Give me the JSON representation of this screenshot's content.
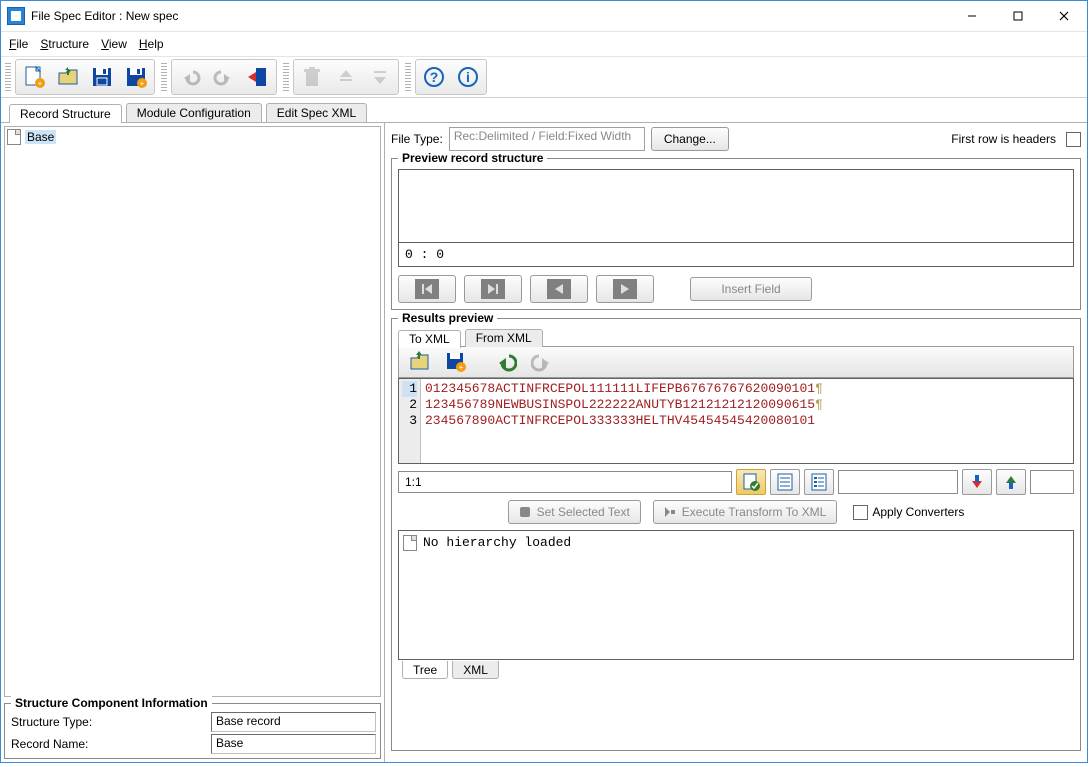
{
  "window": {
    "title": "File Spec Editor : New spec"
  },
  "menubar": {
    "file": "File",
    "structure": "Structure",
    "view": "View",
    "help": "Help"
  },
  "main_tabs": {
    "record_structure": "Record Structure",
    "module_config": "Module Configuration",
    "edit_spec_xml": "Edit Spec XML"
  },
  "tree": {
    "root_label": "Base"
  },
  "sci": {
    "legend": "Structure Component Information",
    "type_label": "Structure Type:",
    "type_value": "Base record",
    "name_label": "Record Name:",
    "name_value": "Base"
  },
  "filetype": {
    "label": "File Type:",
    "placeholder": "Rec:Delimited / Field:Fixed Width",
    "change_btn": "Change...",
    "first_row_label": "First row is headers"
  },
  "preview": {
    "legend": "Preview record structure",
    "status": "0 : 0",
    "insert_btn": "Insert Field"
  },
  "results": {
    "legend": "Results preview",
    "tab_to_xml": "To XML",
    "tab_from_xml": "From XML",
    "lines": [
      "012345678ACTINFRCEPOL111111LIFEPB67676767620090101",
      "123456789NEWBUSINSPOL222222ANUTYB12121212120090615",
      "234567890ACTINFRCEPOL333333HELTHV45454545420080101"
    ],
    "gutter": [
      "1",
      "2",
      "3"
    ],
    "position": "1:1",
    "set_selected": "Set Selected Text",
    "execute": "Execute Transform To XML",
    "apply_converters": "Apply Converters"
  },
  "hierarchy": {
    "empty": "No hierarchy loaded",
    "tab_tree": "Tree",
    "tab_xml": "XML"
  }
}
